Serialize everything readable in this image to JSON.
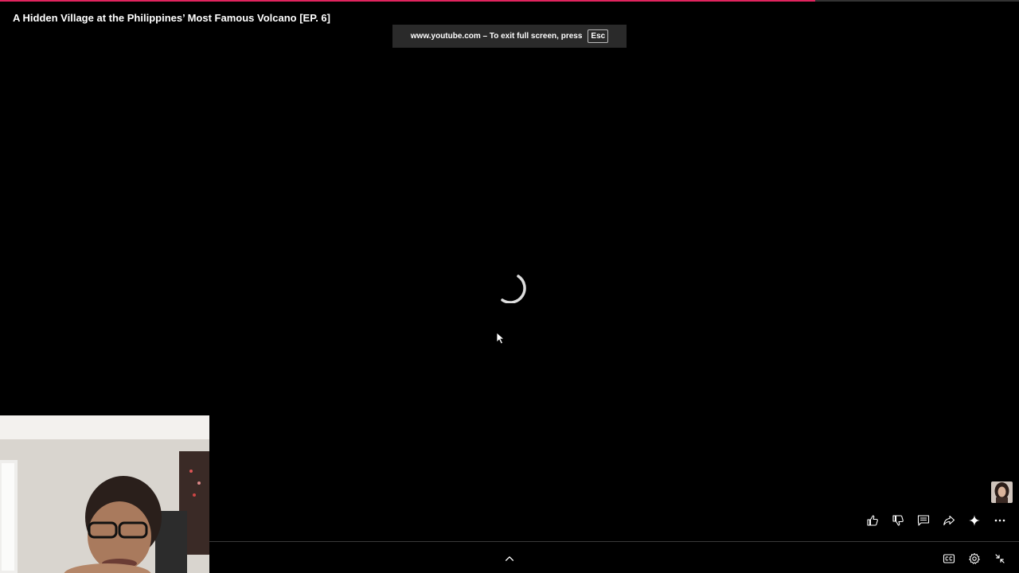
{
  "playback": {
    "progress_fraction": 0.8
  },
  "video": {
    "title": "A Hidden Village at the Philippines’ Most Famous Volcano [EP. 6]"
  },
  "fullscreen_notice": {
    "text": "www.youtube.com – To exit full screen, press",
    "key": "Esc"
  },
  "icons": {
    "like": "thumbs-up-icon",
    "dislike": "thumbs-down-icon",
    "comments": "comment-icon",
    "share": "share-icon",
    "remix": "sparkle-icon",
    "more": "more-horizontal-icon",
    "expand": "chevron-up-icon",
    "captions": "closed-captions-icon",
    "settings": "gear-icon",
    "exit_fullscreen": "exit-fullscreen-icon"
  },
  "colors": {
    "progress": "#e0245e",
    "background": "#000000",
    "notice_bg": "#2a2a2a"
  }
}
